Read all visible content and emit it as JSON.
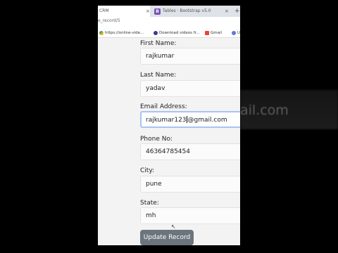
{
  "browser": {
    "tabs": [
      {
        "label": "CRM",
        "active": true
      },
      {
        "label": "Tables · Bootstrap v5.0",
        "active": false
      }
    ],
    "url": "e_record/5",
    "bookmarks": [
      {
        "label": "https://online-vide..."
      },
      {
        "label": "Download videos fr..."
      },
      {
        "label": "Gmail"
      },
      {
        "label": "U"
      }
    ]
  },
  "form": {
    "first_name": {
      "label": "First Name:",
      "value": "rajkumar"
    },
    "last_name": {
      "label": "Last Name:",
      "value": "yadav"
    },
    "email": {
      "label": "Email Address:",
      "value_before_caret": "rajkumar123",
      "value_after_caret": "@gmail.com"
    },
    "phone": {
      "label": "Phone No:",
      "value": "46364785454"
    },
    "city": {
      "label": "City:",
      "value": "pune"
    },
    "state": {
      "label": "State:",
      "value": "mh"
    },
    "submit_label": "Update Record"
  },
  "background": {
    "blurred_text": "ail.com"
  },
  "colors": {
    "button": "#6c757d",
    "focus_border": "#a9c5ef",
    "bootstrap_icon": "#7952b3"
  }
}
